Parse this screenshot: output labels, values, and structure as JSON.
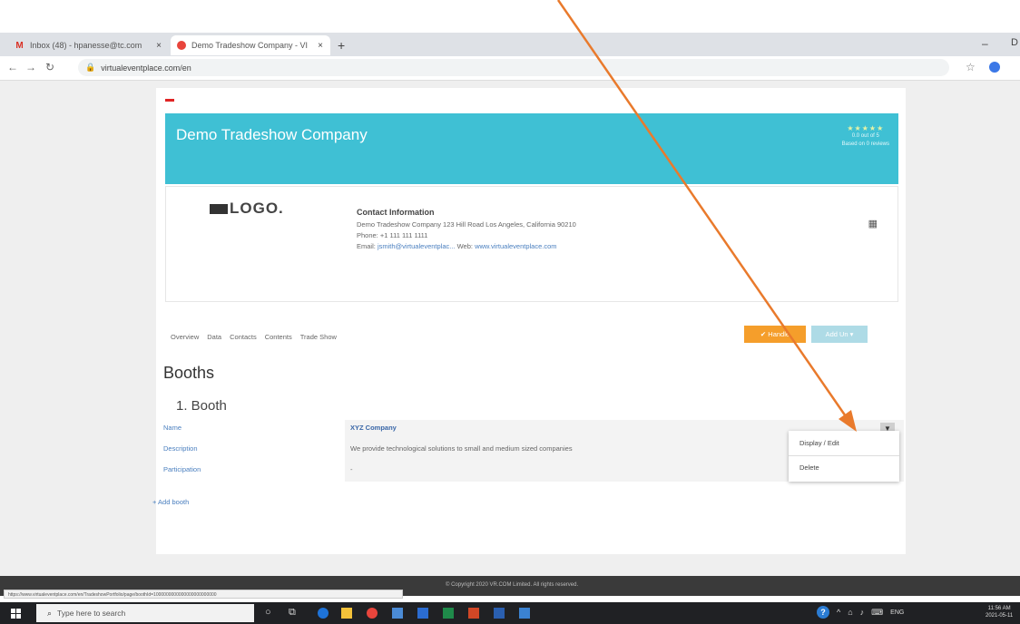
{
  "browser": {
    "tabs": [
      {
        "title": "Inbox (48) - hpanesse@tc.com",
        "favicon": "gmail-icon"
      },
      {
        "title": "Demo Tradeshow Company - VI",
        "favicon": "site-icon"
      }
    ],
    "new_tab": "+",
    "url": "virtualeventplace.com/en",
    "window_min": "–",
    "window_label": "D"
  },
  "banner": {
    "company": "Demo Tradeshow Company",
    "stars": "★★★★★",
    "rating_line1": "0.0 out of 5",
    "rating_line2": "Based on 0 reviews"
  },
  "logo": {
    "text": "LOGO."
  },
  "contact": {
    "title": "Contact Information",
    "address": "Demo Tradeshow Company 123 Hill Road Los Angeles, California 90210",
    "phone": "Phone: +1 111 111 1111",
    "email_label": "Email:",
    "email": "jsmith@virtualeventplac...",
    "web_label": "Web:",
    "web": "www.virtualeventplace.com"
  },
  "nav_tabs": [
    "Overview",
    "Data",
    "Contacts",
    "Contents",
    "Trade Show"
  ],
  "actions": {
    "handle": "✔ Handle",
    "add": "Add Un ▾"
  },
  "booths": {
    "title": "Booths",
    "booth_label": "1. Booth",
    "fields": [
      {
        "label": "Name",
        "value": "XYZ Company"
      },
      {
        "label": "Description",
        "value": "We provide technological solutions to small and medium sized companies"
      },
      {
        "label": "Participation",
        "value": "-"
      }
    ],
    "add_link": "+ Add booth"
  },
  "dropdown": {
    "items": [
      "Display / Edit",
      "Delete"
    ]
  },
  "footer": {
    "copyright": "© Copyright 2020 VR.COM Limited. All rights reserved.",
    "status_url": "https://www.virtualeventplace.com/en/TradeshowPortfolio/page/boothId=1000000000000000000000000"
  },
  "taskbar": {
    "search_placeholder": "Type here to search",
    "lang": "ENG",
    "time": "11:56 AM",
    "date": "2021-05-11"
  },
  "colors": {
    "banner": "#3fc0d4",
    "accent_orange": "#f59e2b",
    "arrow": "#e97a2c",
    "link": "#4a7fbf"
  }
}
